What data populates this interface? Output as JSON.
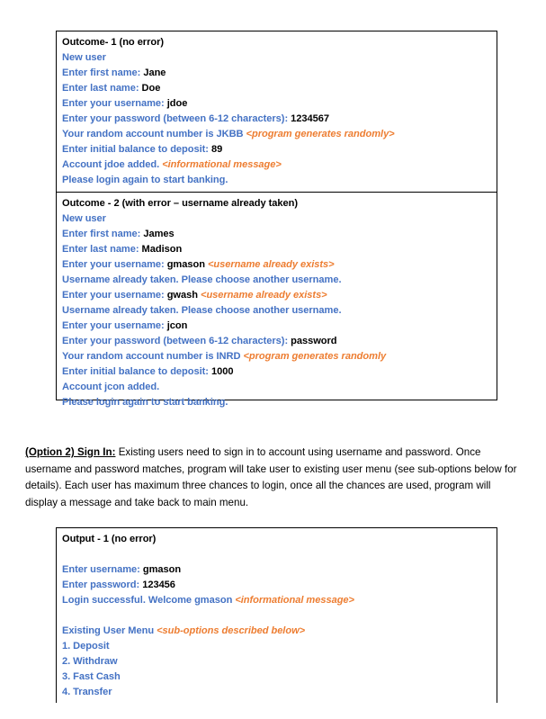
{
  "colors": {
    "prompt_blue": "#4472C4",
    "annotation_orange": "#ED7D31",
    "text_black": "#000000",
    "border_black": "#000000"
  },
  "outcome_box": {
    "cells": [
      {
        "title": "Outcome- 1 (no error)",
        "lines": [
          {
            "label": "New user"
          },
          {
            "label": "Enter first name: ",
            "value": "Jane"
          },
          {
            "label": "Enter last name: ",
            "value": "Doe"
          },
          {
            "label": "Enter your username: ",
            "value": "jdoe"
          },
          {
            "label": "Enter your password (between 6-12 characters): ",
            "value": "1234567"
          },
          {
            "label": "Your random account number is JKBB ",
            "note": "<program generates randomly>"
          },
          {
            "label": "Enter initial balance to deposit: ",
            "value": "89"
          },
          {
            "label": "Account jdoe added. ",
            "note": "<informational message>"
          },
          {
            "label": "Please login again to start banking."
          }
        ]
      },
      {
        "title": "Outcome - 2 (with error – username already taken)",
        "lines": [
          {
            "label": "New user"
          },
          {
            "label": "Enter first name: ",
            "value": "James"
          },
          {
            "label": "Enter last name: ",
            "value": "Madison"
          },
          {
            "label": "Enter your username: ",
            "value": "gmason",
            "note": " <username already exists>"
          },
          {
            "label": "Username already taken. Please choose another username."
          },
          {
            "label": "Enter your username: ",
            "value": "gwash",
            "note": " <username already exists>"
          },
          {
            "label": "Username already taken. Please choose another username."
          },
          {
            "label": "Enter your username: ",
            "value": "jcon"
          },
          {
            "label": "Enter your password (between 6-12 characters): ",
            "value": "password"
          },
          {
            "label": "Your random account number is INRD ",
            "note": "<program generates randomly"
          },
          {
            "label": "Enter initial balance to deposit: ",
            "value": "1000"
          },
          {
            "label": "Account jcon added."
          },
          {
            "label": "Please login again to start banking."
          }
        ]
      }
    ]
  },
  "signin_section": {
    "lead": "(Option 2) Sign In:",
    "body": " Existing users need to sign in to account using username and password. Once username and password matches, program will take user to existing user menu (see sub-options below for details). Each user has maximum three chances to login, once all the chances are used, program will display a message and take back to main menu."
  },
  "output_box": {
    "cells": [
      {
        "title": "Output - 1 (no error)",
        "lines": [
          {
            "blank": true
          },
          {
            "label": "Enter username: ",
            "value": "gmason"
          },
          {
            "label": "Enter password: ",
            "value": "123456"
          },
          {
            "label": "Login successful. Welcome gmason ",
            "note": "<informational message>"
          },
          {
            "blank": true
          },
          {
            "label": "Existing User Menu ",
            "note": "<sub-options described below>"
          },
          {
            "label": "1. Deposit"
          },
          {
            "label": "2. Withdraw"
          },
          {
            "label": "3. Fast Cash"
          },
          {
            "label": "4. Transfer"
          }
        ]
      }
    ]
  }
}
